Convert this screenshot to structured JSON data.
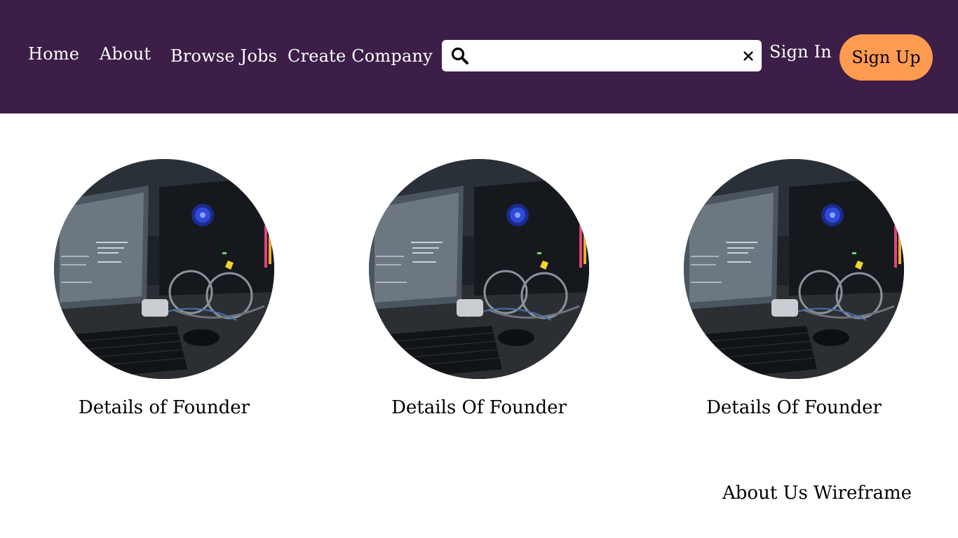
{
  "nav": {
    "links": [
      {
        "label": "Home"
      },
      {
        "label": "About"
      },
      {
        "label": "Browse Jobs"
      },
      {
        "label": "Create Company"
      }
    ],
    "search": {
      "value": "",
      "placeholder": "",
      "icon": "search-icon",
      "clear_icon": "close-icon"
    },
    "sign_in_label": "Sign In",
    "sign_up_label": "Sign Up"
  },
  "colors": {
    "navbar_bg": "#3d1e48",
    "signup_bg": "#ff9b50",
    "text_light": "#ffffff"
  },
  "founders": [
    {
      "caption": "Details of Founder",
      "image": "computer-workstation-photo"
    },
    {
      "caption": "Details Of Founder",
      "image": "computer-workstation-photo"
    },
    {
      "caption": "Details Of Founder",
      "image": "computer-workstation-photo"
    }
  ],
  "footer": {
    "title": "About Us Wireframe"
  }
}
